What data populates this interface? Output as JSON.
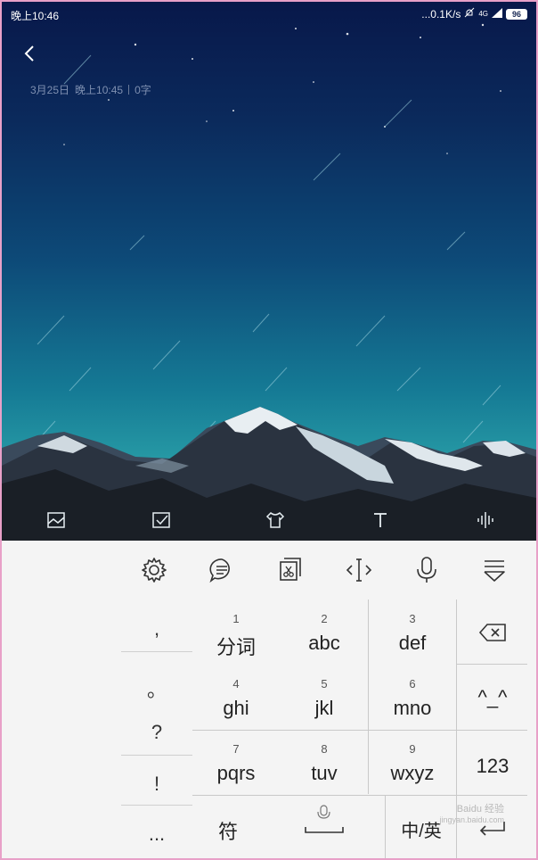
{
  "status_bar": {
    "time": "晚上10:46",
    "net_speed": "...0.1K/s",
    "signal": "4G",
    "battery": "96"
  },
  "note": {
    "date": "3月25日",
    "time": "晚上10:45",
    "word_count": "0字"
  },
  "note_toolbar": {
    "icons": [
      "image-icon",
      "checkbox-icon",
      "theme-shirt-icon",
      "text-format-icon",
      "audio-wave-icon"
    ]
  },
  "keyboard_toolbar": {
    "icons": [
      "settings-gear-icon",
      "chat-bubble-icon",
      "clipboard-cut-icon",
      "cursor-move-icon",
      "microphone-icon",
      "keyboard-hide-icon"
    ]
  },
  "keyboard": {
    "symbols": [
      ",",
      "。",
      "?",
      "!",
      "..."
    ],
    "keys": [
      {
        "num": "1",
        "label": "分词"
      },
      {
        "num": "2",
        "label": "abc"
      },
      {
        "num": "3",
        "label": "def"
      },
      {
        "num": "4",
        "label": "ghi"
      },
      {
        "num": "5",
        "label": "jkl"
      },
      {
        "num": "6",
        "label": "mno"
      },
      {
        "num": "7",
        "label": "pqrs"
      },
      {
        "num": "8",
        "label": "tuv"
      },
      {
        "num": "9",
        "label": "wxyz"
      }
    ],
    "emoticon": "^_^",
    "numeric": "123",
    "symbol_key": "符",
    "lang_key": "中/英"
  },
  "watermark": {
    "line1": "Baidu 经验",
    "line2": "jingyan.baidu.com"
  }
}
